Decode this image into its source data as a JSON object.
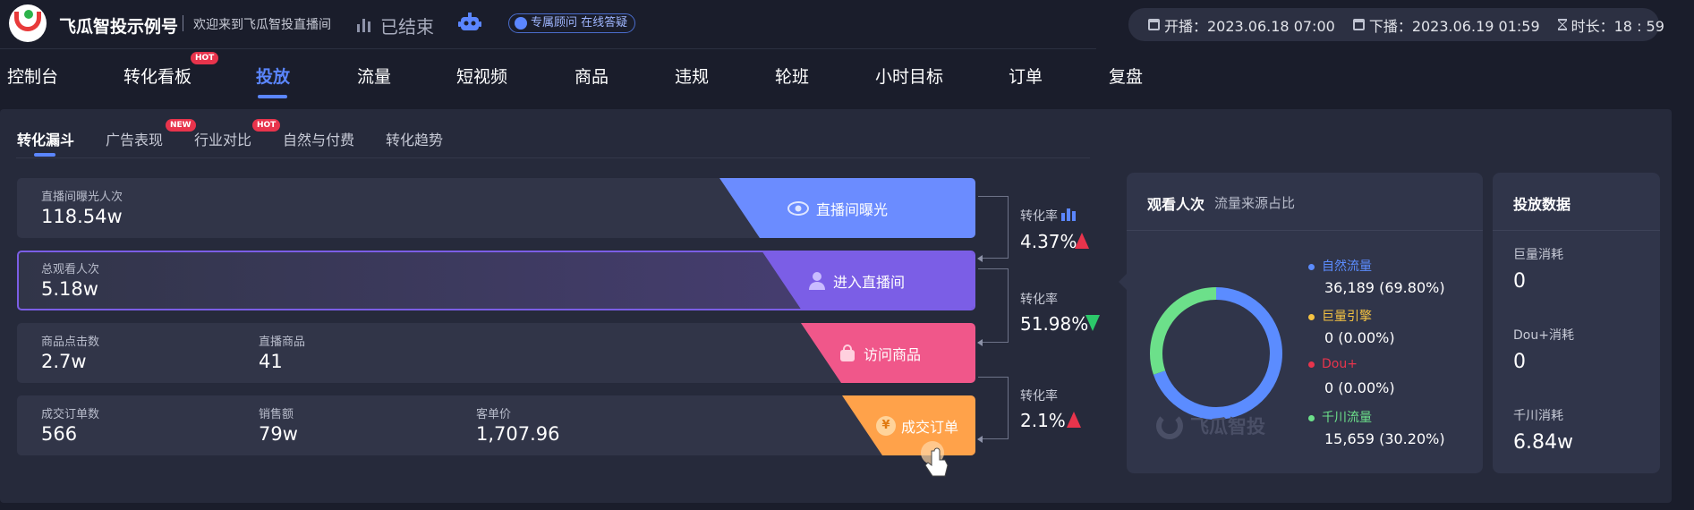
{
  "header": {
    "brand": "飞瓜智投示例号",
    "welcome": "欢迎来到飞瓜智投直播间",
    "status": "已结束",
    "advisor": "专属顾问 在线答疑",
    "start_time": "开播：2023.06.18 07:00",
    "end_time": "下播：2023.06.19 01:59",
    "duration": "时长：18 : 59"
  },
  "nav": {
    "items": [
      "控制台",
      "转化看板",
      "投放",
      "流量",
      "短视频",
      "商品",
      "违规",
      "轮班",
      "小时目标",
      "订单",
      "复盘"
    ],
    "active": "投放",
    "hot_badge": "HOT"
  },
  "subtabs": {
    "items": [
      "转化漏斗",
      "广告表现",
      "行业对比",
      "自然与付费",
      "转化趋势"
    ],
    "active": "转化漏斗",
    "new_badge": "NEW",
    "hot_badge": "HOT"
  },
  "funnel": {
    "row1": {
      "cap": "直播间曝光人次",
      "val": "118.54w",
      "tag": "直播间曝光"
    },
    "row2": {
      "cap": "总观看人次",
      "val": "5.18w",
      "tag": "进入直播间"
    },
    "row3": {
      "cap1": "商品点击数",
      "val1": "2.7w",
      "cap2": "直播商品",
      "val2": "41",
      "tag": "访问商品"
    },
    "row4": {
      "cap1": "成交订单数",
      "val1": "566",
      "cap2": "销售额",
      "val2": "79w",
      "cap3": "客单价",
      "val3": "1,707.96",
      "tag": "成交订单",
      "yen": "¥"
    },
    "rates": [
      {
        "label": "转化率",
        "value": "4.37%",
        "trend": "up"
      },
      {
        "label": "转化率",
        "value": "51.98%",
        "trend": "down"
      },
      {
        "label": "转化率",
        "value": "2.1%",
        "trend": "up"
      }
    ]
  },
  "views_card": {
    "title": "观看人次",
    "subtitle": "流量来源占比",
    "watermark": "飞瓜智投",
    "legend": [
      {
        "name": "自然流量",
        "value": "36,189  (69.80%)",
        "color": "#5b8cff",
        "share": 69.8
      },
      {
        "name": "巨量引擎",
        "value": "0  (0.00%)",
        "color": "#f5c342",
        "share": 0
      },
      {
        "name": "Dou+",
        "value": "0  (0.00%)",
        "color": "#e8344c",
        "share": 0
      },
      {
        "name": "千川流量",
        "value": "15,659  (30.20%)",
        "color": "#6ce08a",
        "share": 30.2
      }
    ]
  },
  "ad_card": {
    "title": "投放数据",
    "items": [
      {
        "label": "巨量消耗",
        "value": "0"
      },
      {
        "label": "Dou+消耗",
        "value": "0"
      },
      {
        "label": "千川消耗",
        "value": "6.84w"
      }
    ]
  },
  "colors": {
    "accent": "#5b86ff",
    "exposure": "#6b8cff",
    "enter": "#7b5ee6",
    "visit": "#f0578a",
    "order": "#ffa24a"
  }
}
